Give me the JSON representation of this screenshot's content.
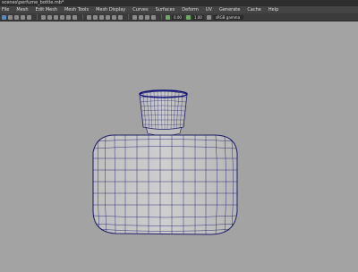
{
  "window": {
    "title": "scenes\\perfume_bottle.mb*"
  },
  "menubar": {
    "mode": "",
    "items": [
      "File",
      "Mesh",
      "Edit Mesh",
      "Mesh Tools",
      "Mesh Display",
      "Curves",
      "Surfaces",
      "Deform",
      "UV",
      "Generate",
      "Cache",
      "Help"
    ]
  },
  "toolbar": {
    "value1": "0.00",
    "value2": "1.00",
    "colorspace": "sRGB gamma"
  },
  "colors": {
    "mesh_fill": "#c4c4c4",
    "mesh_wire": "#1c1c66",
    "viewport": "#a3a3a3"
  },
  "viewport": {
    "object": "perfume-bottle-mesh"
  }
}
